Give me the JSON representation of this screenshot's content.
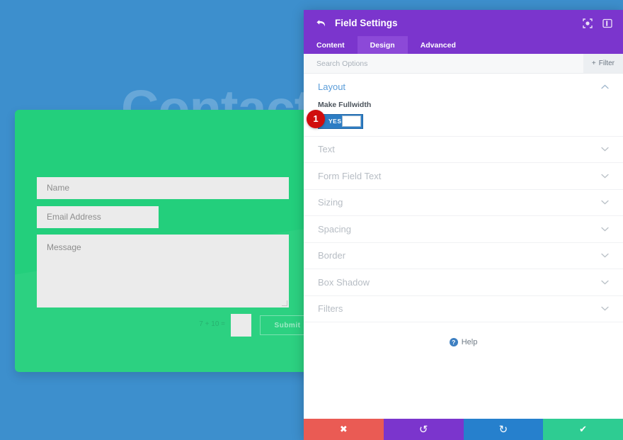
{
  "preview": {
    "background_color": "#3d8fcd",
    "heading": "Contact",
    "card_color": "#23cf7c",
    "form": {
      "name_placeholder": "Name",
      "email_placeholder": "Email Address",
      "message_placeholder": "Message",
      "captcha_label": "7 + 10 =",
      "captcha_value": "",
      "submit_label": "Submit"
    }
  },
  "panel": {
    "title": "Field Settings",
    "header_color": "#7b35cd",
    "back_icon": "back-arrow-icon",
    "icons": [
      {
        "name": "focus-target-icon",
        "glyph": "☉"
      },
      {
        "name": "panel-layout-icon",
        "glyph": "▤"
      }
    ],
    "tabs": [
      {
        "label": "Content",
        "active": false
      },
      {
        "label": "Design",
        "active": true
      },
      {
        "label": "Advanced",
        "active": false
      }
    ],
    "search": {
      "placeholder": "Search Options",
      "value": "",
      "filter_label": "Filter",
      "filter_icon": "plus-icon"
    },
    "layout_section": {
      "title": "Layout",
      "expanded": true,
      "chevron": "chevron-up-icon",
      "fullwidth_label": "Make Fullwidth",
      "toggle_state": "YES",
      "toggle_color": "#2d7dc4",
      "step_badge": "1",
      "step_badge_color": "#d00d0d"
    },
    "sections": [
      {
        "title": "Text",
        "expanded": false
      },
      {
        "title": "Form Field Text",
        "expanded": false
      },
      {
        "title": "Sizing",
        "expanded": false
      },
      {
        "title": "Spacing",
        "expanded": false
      },
      {
        "title": "Border",
        "expanded": false
      },
      {
        "title": "Box Shadow",
        "expanded": false
      },
      {
        "title": "Filters",
        "expanded": false
      }
    ],
    "help_label": "Help",
    "footer_buttons": [
      {
        "name": "cancel-button",
        "icon": "close-icon",
        "glyph": "✖",
        "color": "#ea5b54"
      },
      {
        "name": "undo-button",
        "icon": "undo-icon",
        "glyph": "↺",
        "color": "#7b35cd"
      },
      {
        "name": "redo-button",
        "icon": "redo-icon",
        "glyph": "↻",
        "color": "#2680cd"
      },
      {
        "name": "save-button",
        "icon": "checkmark-icon",
        "glyph": "✔",
        "color": "#2ecc92"
      }
    ]
  }
}
